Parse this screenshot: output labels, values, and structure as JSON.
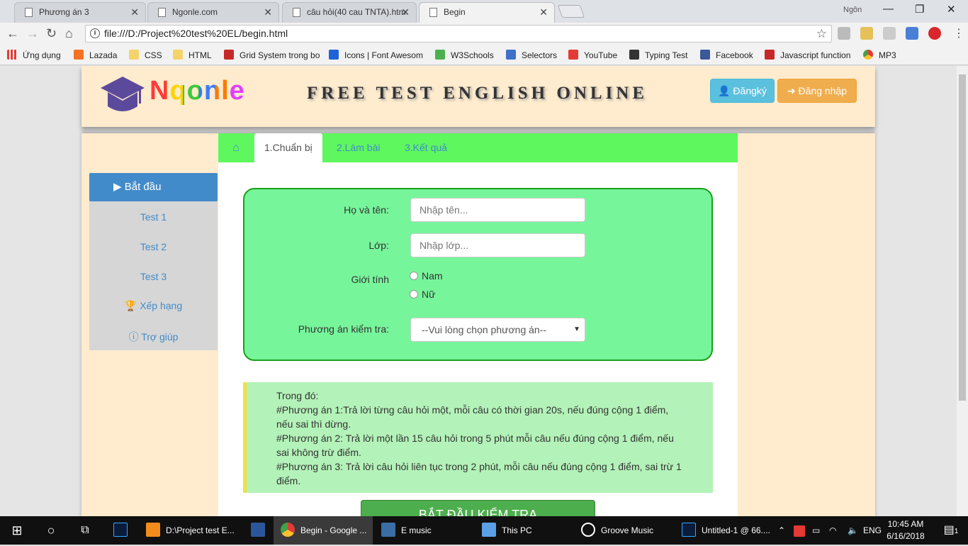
{
  "browser": {
    "tabs": [
      {
        "title": "Phương án 3"
      },
      {
        "title": "Ngonle.com"
      },
      {
        "title": "câu hỏi(40 cau TNTA).htm"
      },
      {
        "title": "Begin"
      }
    ],
    "user": "Ngôn",
    "url": "file:///D:/Project%20test%20EL/begin.html",
    "bookmarks": [
      "Ứng dụng",
      "Lazada",
      "CSS",
      "HTML",
      "Grid System trong bo",
      "Icons | Font Awesom",
      "W3Schools",
      "Selectors",
      "YouTube",
      "Typing Test",
      "Facebook",
      "Javascript function",
      "MP3"
    ]
  },
  "header": {
    "logo_text": "Nqonle",
    "title": "FREE TEST ENGLISH ONLINE",
    "register_label": "Đăngký",
    "login_label": "Đăng nhập"
  },
  "sidebar": {
    "start_label": "Bắt đầu",
    "items": [
      {
        "label": "Test 1"
      },
      {
        "label": "Test 2"
      },
      {
        "label": "Test 3"
      },
      {
        "label": "Xếp hạng"
      },
      {
        "label": "Trợ giúp"
      }
    ]
  },
  "tabs": {
    "prepare": "1.Chuẩn bị",
    "do_test": "2.Làm bài",
    "result": "3.Kết quả"
  },
  "form": {
    "name_label": "Họ và tên:",
    "name_placeholder": "Nhập tên...",
    "class_label": "Lớp:",
    "class_placeholder": "Nhập lớp...",
    "gender_label": "Giới tính",
    "gender_male": "Nam",
    "gender_female": "Nữ",
    "method_label": "Phương án kiểm tra:",
    "method_selected": "--Vui lòng chọn phương án--"
  },
  "note": {
    "line1": "Trong đó:",
    "line2": "#Phương án 1:Trả lời từng câu hỏi một, mỗi câu có thời gian 20s, nếu đúng cộng 1 điểm, nếu sai thì dừng.",
    "line3": "#Phương án 2: Trả lời một lần 15 câu hỏi trong 5 phút mỗi câu nếu đúng cộng 1 điểm, nếu sai không trừ điểm.",
    "line4": "#Phương án 3: Trả lời câu hỏi liên tục trong 2 phút, mỗi câu nếu đúng cộng 1 điểm, sai trừ 1 điểm."
  },
  "start_button": "BẮT ĐẦU KIỂM TRA",
  "taskbar": {
    "items": [
      "D:\\Project test E...",
      "Begin - Google ...",
      "E music",
      "This PC",
      "Groove Music",
      "Untitled-1 @ 66...."
    ],
    "lang": "ENG",
    "time": "10:45 AM",
    "date": "6/16/2018",
    "notifications": "1"
  }
}
